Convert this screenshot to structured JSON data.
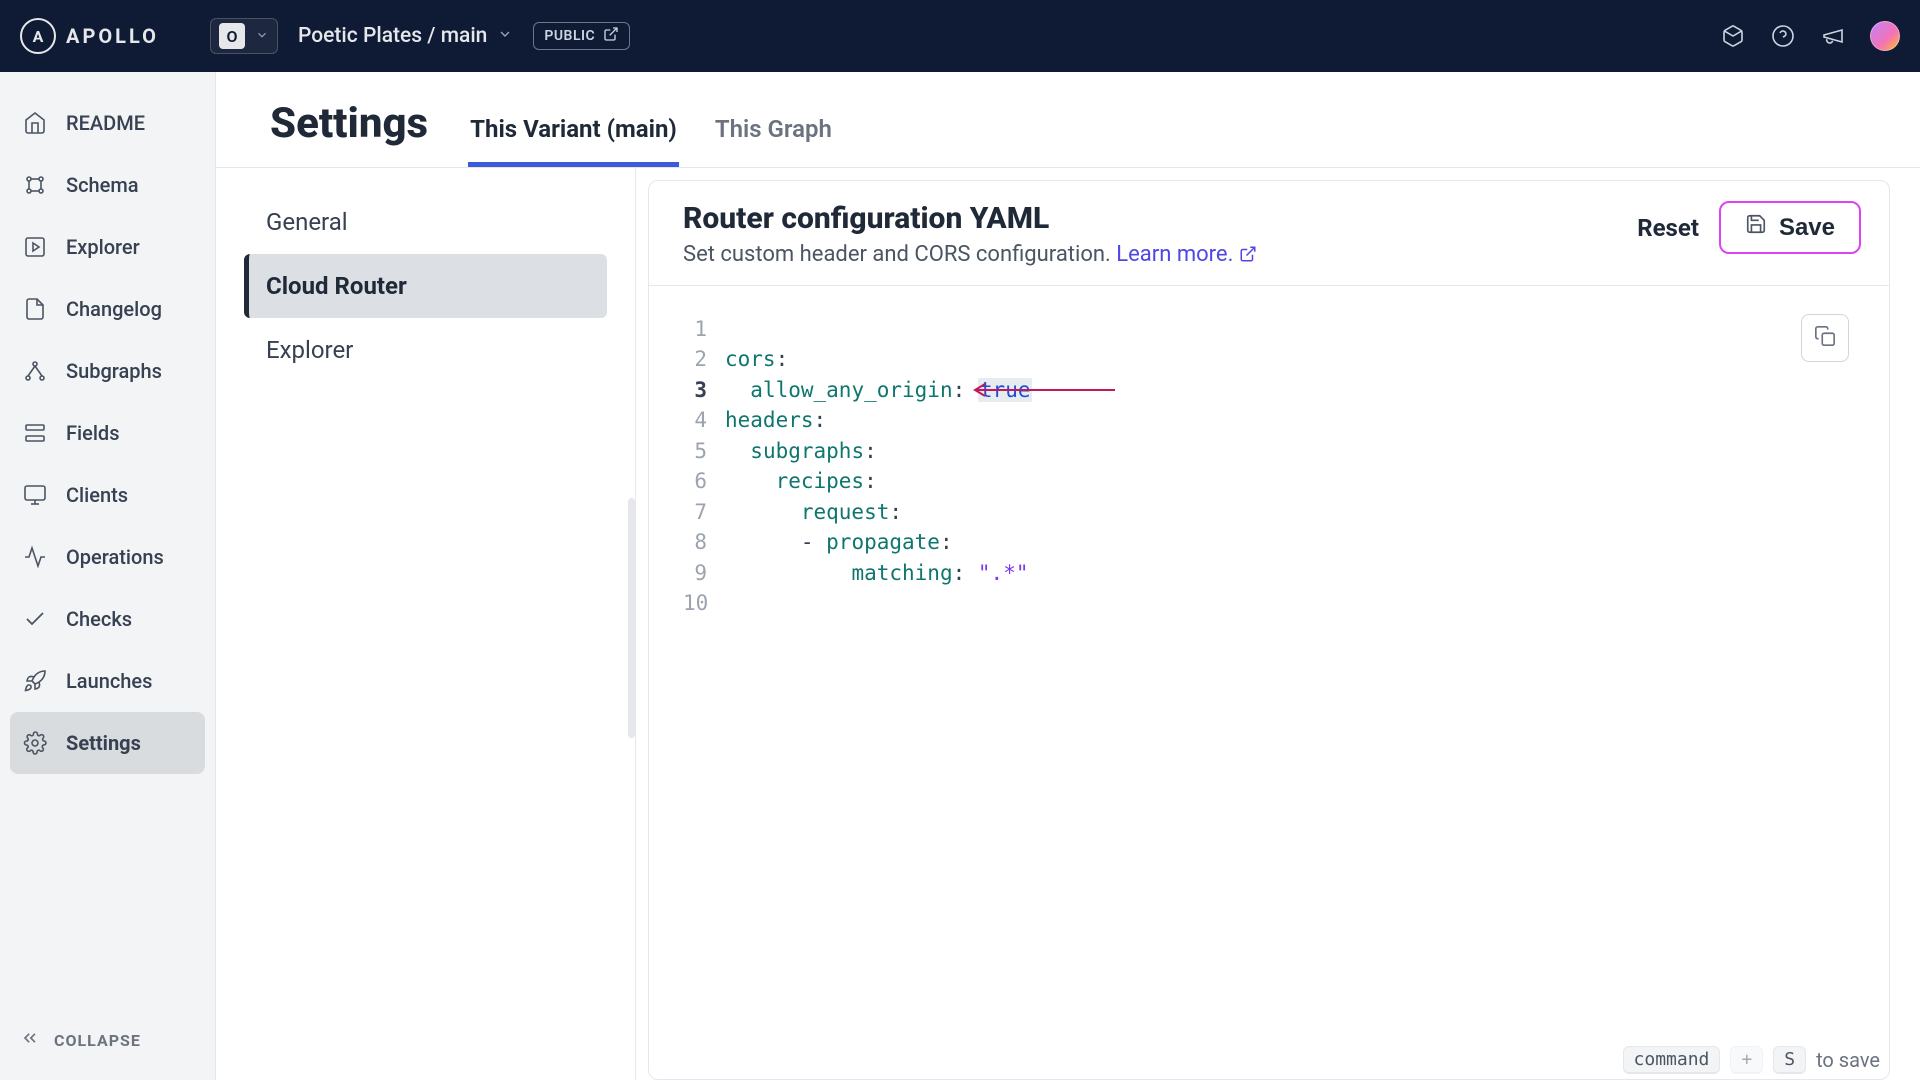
{
  "header": {
    "brand_letter": "A",
    "brand_word": "APOLLO",
    "org_letter": "O",
    "graph_name": "Poetic Plates",
    "variant_name": "main",
    "graph_crumb": "Poetic Plates / main",
    "public_badge": "PUBLIC"
  },
  "nav": {
    "items": [
      {
        "key": "readme",
        "label": "README"
      },
      {
        "key": "schema",
        "label": "Schema"
      },
      {
        "key": "explorer",
        "label": "Explorer"
      },
      {
        "key": "changelog",
        "label": "Changelog"
      },
      {
        "key": "subgraphs",
        "label": "Subgraphs"
      },
      {
        "key": "fields",
        "label": "Fields"
      },
      {
        "key": "clients",
        "label": "Clients"
      },
      {
        "key": "operations",
        "label": "Operations"
      },
      {
        "key": "checks",
        "label": "Checks"
      },
      {
        "key": "launches",
        "label": "Launches"
      },
      {
        "key": "settings",
        "label": "Settings"
      }
    ],
    "active_key": "settings",
    "collapse": "COLLAPSE"
  },
  "page": {
    "title": "Settings",
    "tabs": [
      {
        "key": "variant",
        "label": "This Variant (main)"
      },
      {
        "key": "graph",
        "label": "This Graph"
      }
    ],
    "active_tab": "variant"
  },
  "settings_side": {
    "items": [
      {
        "key": "general",
        "label": "General"
      },
      {
        "key": "cloud_router",
        "label": "Cloud Router"
      },
      {
        "key": "explorer",
        "label": "Explorer"
      }
    ],
    "active_key": "cloud_router"
  },
  "card": {
    "title": "Router configuration YAML",
    "subtitle_prefix": "Set custom header and CORS configuration. ",
    "learn_more": "Learn more.",
    "reset": "Reset",
    "save": "Save"
  },
  "editor": {
    "lines": [
      {
        "n": 1,
        "text": ""
      },
      {
        "n": 2,
        "text": "cors:"
      },
      {
        "n": 3,
        "text": "  allow_any_origin: true",
        "active": true,
        "highlight": "true"
      },
      {
        "n": 4,
        "text": "headers:"
      },
      {
        "n": 5,
        "text": "  subgraphs:"
      },
      {
        "n": 6,
        "text": "    recipes:"
      },
      {
        "n": 7,
        "text": "      request:"
      },
      {
        "n": 8,
        "text": "      - propagate:"
      },
      {
        "n": 9,
        "text": "          matching: \".*\""
      },
      {
        "n": 10,
        "text": ""
      }
    ]
  },
  "footer": {
    "key1": "command",
    "plus": "+",
    "key2": "S",
    "text": "to save"
  },
  "colors": {
    "header_bg": "#0f1a34",
    "accent_pink": "#d946ef",
    "accent_blue": "#3b5bdb",
    "code_key": "#0f766e",
    "code_val": "#1d4ed8",
    "code_str": "#7c3aed"
  }
}
